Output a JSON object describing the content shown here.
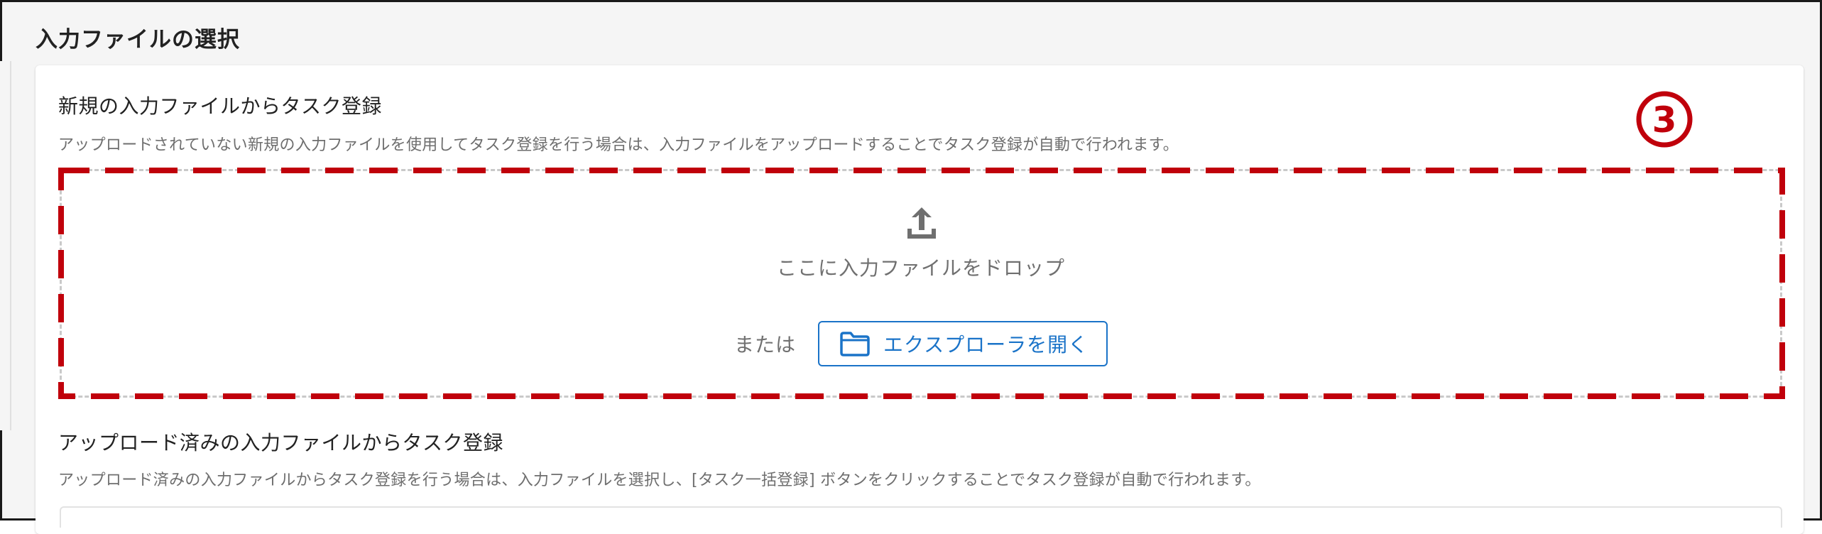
{
  "section": {
    "title": "入力ファイルの選択"
  },
  "new_upload": {
    "title": "新規の入力ファイルからタスク登録",
    "description": "アップロードされていない新規の入力ファイルを使用してタスク登録を行う場合は、入力ファイルをアップロードすることでタスク登録が自動で行われます。",
    "drop_text": "ここに入力ファイルをドロップ",
    "or_text": "または",
    "open_explorer_label": "エクスプローラを開く",
    "icons": {
      "upload": "upload-icon",
      "folder": "folder-icon"
    }
  },
  "uploaded": {
    "title": "アップロード済みの入力ファイルからタスク登録",
    "description": "アップロード済みの入力ファイルからタスク登録を行う場合は、入力ファイルを選択し、[タスク一括登録] ボタンをクリックすることでタスク登録が自動で行われます。"
  },
  "annotation": {
    "step_label": "③",
    "color": "#c0000b"
  },
  "colors": {
    "accent": "#1a73c8",
    "text": "#222222",
    "muted": "#6e6e6e"
  }
}
